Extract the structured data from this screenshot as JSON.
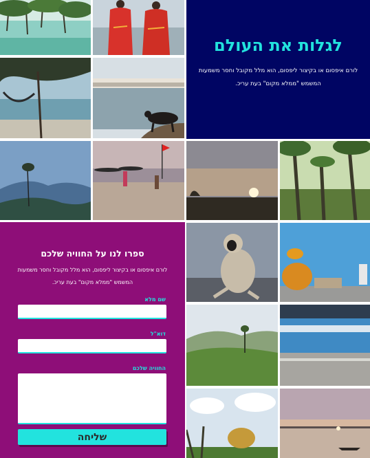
{
  "hero": {
    "title": "לגלות את העולם",
    "text": "לורם איפסום או בקיצור ליפסום, הוא מלל מקובל וחסר משמעות המשמש \"ממלא מקום\" בעת עריכ."
  },
  "form": {
    "title": "ספרו לנו על החוויה שלכם",
    "intro": "לורם איפסום או בקיצור ליפסום, הוא מלל מקובל וחסר משמעות המשמש \"ממלא מקום\" בעת עריכ.",
    "name_label": "שם מלא",
    "email_label": "דוא\"ל",
    "experience_label": "החוויה שלכם",
    "name_value": "",
    "email_value": "",
    "experience_value": "",
    "submit_label": "שליחה"
  },
  "colors": {
    "navy": "#000563",
    "purple": "#8e0e78",
    "turquoise": "#22e3de"
  }
}
